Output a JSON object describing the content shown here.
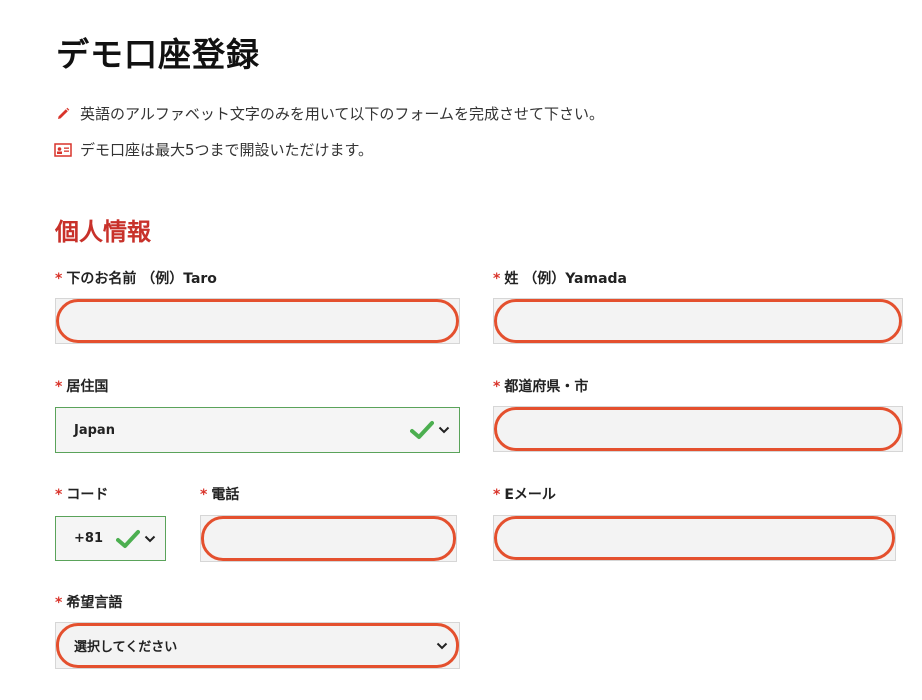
{
  "title": "デモ口座登録",
  "notes": [
    {
      "icon": "pencil-icon",
      "text": "英語のアルファベット文字のみを用いて以下のフォームを完成させて下さい。"
    },
    {
      "icon": "id-card-icon",
      "text": "デモ口座は最大5つまで開設いただけます。"
    }
  ],
  "section_title": "個人情報",
  "required_mark": "*",
  "fields": {
    "first_name": {
      "label": "下のお名前 （例）Taro",
      "value": ""
    },
    "last_name": {
      "label": "姓 （例）Yamada",
      "value": ""
    },
    "country": {
      "label": "居住国",
      "value": "Japan"
    },
    "city": {
      "label": "都道府県・市",
      "value": ""
    },
    "code": {
      "label": "コード",
      "value": "+81"
    },
    "phone": {
      "label": "電話",
      "value": ""
    },
    "email": {
      "label": "Eメール",
      "value": ""
    },
    "language": {
      "label": "希望言語",
      "value": "選択してください"
    }
  },
  "colors": {
    "accent_red": "#c8312a",
    "highlight_ring": "#e4502e",
    "valid_green": "#4caf50"
  }
}
